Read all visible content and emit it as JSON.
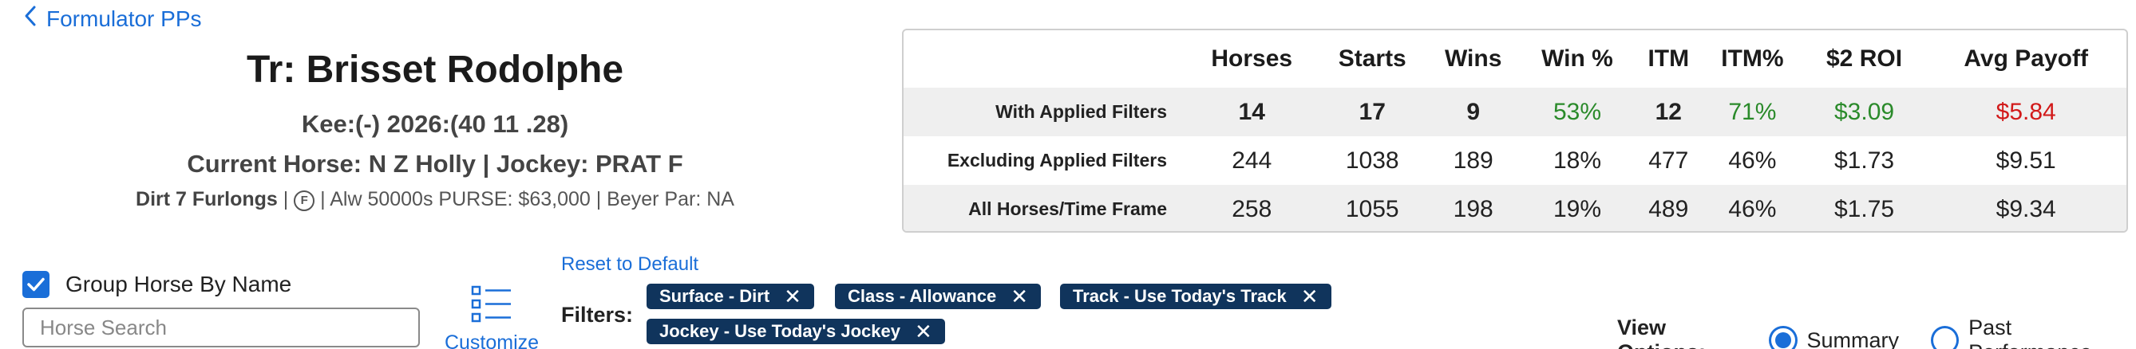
{
  "back_link": {
    "label": "Formulator PPs"
  },
  "header": {
    "trainer": "Tr: Brisset Rodolphe",
    "kee_line": "Kee:(-) 2026:(40 11 .28)",
    "current_line": "Current Horse: N Z Holly | Jockey: PRAT F",
    "race": {
      "surface_distance": "Dirt 7 Furlongs",
      "sep1": " | ",
      "circle_icon": "F",
      "rest": " | Alw 50000s PURSE: $63,000 | Beyer Par: NA"
    }
  },
  "stats": {
    "columns": [
      "Horses",
      "Starts",
      "Wins",
      "Win %",
      "ITM",
      "ITM%",
      "$2 ROI",
      "Avg Payoff"
    ],
    "rows": [
      {
        "label": "With Applied Filters",
        "values": [
          "14",
          "17",
          "9",
          "53%",
          "12",
          "71%",
          "$3.09",
          "$5.84"
        ]
      },
      {
        "label": "Excluding Applied Filters",
        "values": [
          "244",
          "1038",
          "189",
          "18%",
          "477",
          "46%",
          "$1.73",
          "$9.51"
        ]
      },
      {
        "label": "All Horses/Time Frame",
        "values": [
          "258",
          "1055",
          "198",
          "19%",
          "489",
          "46%",
          "$1.75",
          "$9.34"
        ]
      }
    ],
    "colors": {
      "positive": "#2a8a2a",
      "negative": "#d21a1a"
    }
  },
  "controls": {
    "group_by_label": "Group Horse By Name",
    "group_by_checked": true,
    "search_placeholder": "Horse Search",
    "customize_label": "Customize",
    "reset_label": "Reset to Default",
    "filters_label": "Filters:",
    "chips": [
      "Surface - Dirt",
      "Class - Allowance",
      "Track - Use Today's Track",
      "Jockey - Use Today's Jockey"
    ],
    "view_options_label": "View Options:",
    "view_options": [
      {
        "label": "Summary",
        "selected": true
      },
      {
        "label": "Past Performance",
        "selected": false
      }
    ]
  },
  "theme": {
    "accent": "#1a6ed8",
    "chip_bg": "#10345c"
  }
}
